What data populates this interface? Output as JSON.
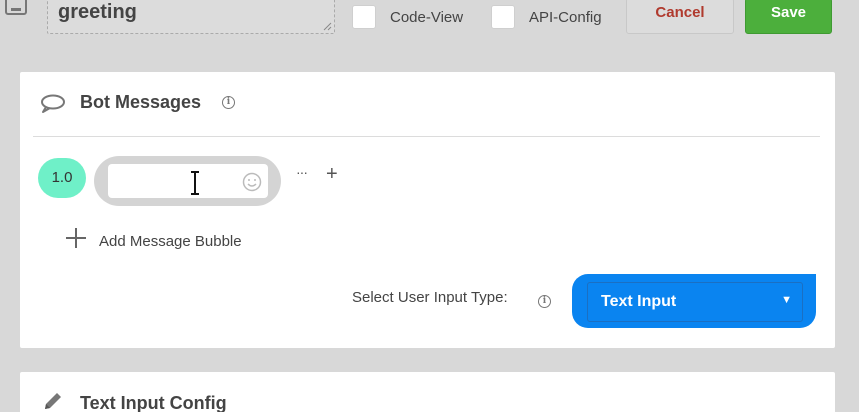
{
  "topbar": {
    "name_value": "greeting",
    "code_view_label": "Code-View",
    "api_config_label": "API-Config",
    "cancel_label": "Cancel",
    "save_label": "Save"
  },
  "bot_messages": {
    "title": "Bot Messages",
    "version": "1.0",
    "more_label": "···",
    "plus_label": "+",
    "add_bubble_label": "Add Message Bubble",
    "input_type_label": "Select User Input Type:",
    "input_type_value": "Text Input"
  },
  "text_input_config": {
    "title": "Text Input Config"
  },
  "icons": {
    "disk": "save-disk-icon",
    "bubble": "speech-bubble-icon",
    "info": "info-icon",
    "cursor": "text-cursor-icon",
    "emoji": "emoji-icon",
    "plus": "plus-icon",
    "chevron": "chevron-down-icon",
    "pencil": "pencil-icon"
  },
  "colors": {
    "accent_select": "#0a84f0",
    "save_button": "#4caf3c",
    "cancel_text": "#b03a2e",
    "version_badge": "#6ff0c8"
  }
}
